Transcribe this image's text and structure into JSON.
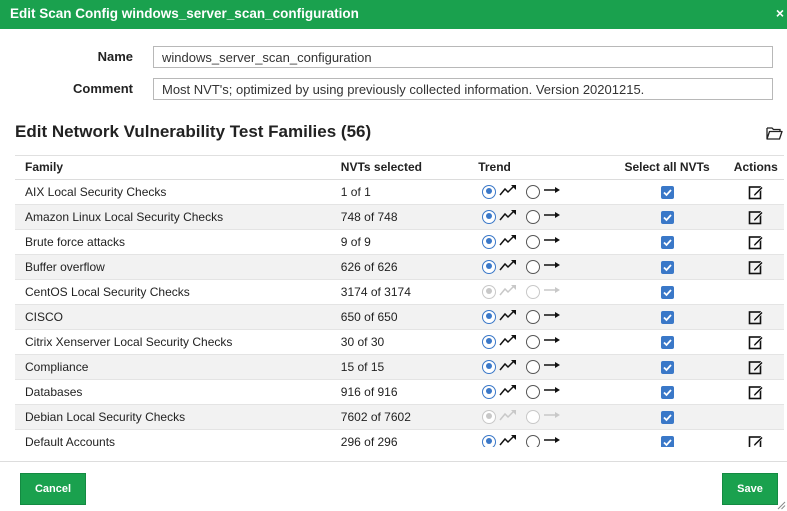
{
  "dialog": {
    "title": "Edit Scan Config windows_server_scan_configuration",
    "close_label": "×"
  },
  "form": {
    "name_label": "Name",
    "name_value": "windows_server_scan_configuration",
    "comment_label": "Comment",
    "comment_value": "Most NVT's; optimized by using previously collected information. Version 20201215."
  },
  "section": {
    "title": "Edit Network Vulnerability Test Families (56)"
  },
  "table": {
    "headers": {
      "family": "Family",
      "nvts": "NVTs selected",
      "trend": "Trend",
      "select_all": "Select all NVTs",
      "actions": "Actions"
    },
    "rows": [
      {
        "family": "AIX Local Security Checks",
        "nvts": "1 of 1",
        "trend": "growing",
        "disabled": false,
        "selected": true,
        "editable": true
      },
      {
        "family": "Amazon Linux Local Security Checks",
        "nvts": "748 of 748",
        "trend": "growing",
        "disabled": false,
        "selected": true,
        "editable": true
      },
      {
        "family": "Brute force attacks",
        "nvts": "9 of 9",
        "trend": "growing",
        "disabled": false,
        "selected": true,
        "editable": true
      },
      {
        "family": "Buffer overflow",
        "nvts": "626 of 626",
        "trend": "growing",
        "disabled": false,
        "selected": true,
        "editable": true
      },
      {
        "family": "CentOS Local Security Checks",
        "nvts": "3174 of 3174",
        "trend": "growing",
        "disabled": true,
        "selected": true,
        "editable": false
      },
      {
        "family": "CISCO",
        "nvts": "650 of 650",
        "trend": "growing",
        "disabled": false,
        "selected": true,
        "editable": true
      },
      {
        "family": "Citrix Xenserver Local Security Checks",
        "nvts": "30 of 30",
        "trend": "growing",
        "disabled": false,
        "selected": true,
        "editable": true
      },
      {
        "family": "Compliance",
        "nvts": "15 of 15",
        "trend": "growing",
        "disabled": false,
        "selected": true,
        "editable": true
      },
      {
        "family": "Databases",
        "nvts": "916 of 916",
        "trend": "growing",
        "disabled": false,
        "selected": true,
        "editable": true
      },
      {
        "family": "Debian Local Security Checks",
        "nvts": "7602 of 7602",
        "trend": "growing",
        "disabled": true,
        "selected": true,
        "editable": false
      },
      {
        "family": "Default Accounts",
        "nvts": "296 of 296",
        "trend": "growing",
        "disabled": false,
        "selected": true,
        "editable": true
      }
    ]
  },
  "footer": {
    "cancel_label": "Cancel",
    "save_label": "Save"
  },
  "colors": {
    "accent": "#1aa14e",
    "radio_blue": "#3a78c8"
  },
  "icons": {
    "close": "close-icon",
    "folder": "folder-icon",
    "trend_up": "trend-growing-icon",
    "trend_static": "trend-static-icon",
    "edit": "edit-icon",
    "checkbox": "checkbox-checked-icon"
  }
}
